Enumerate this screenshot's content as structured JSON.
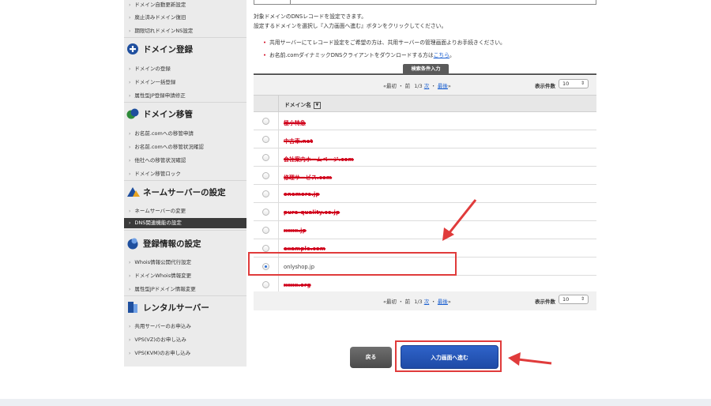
{
  "sidebar": {
    "links_top": [
      "ドメイン自動更新設定",
      "廃止済みドメイン復旧",
      "期限切れドメインNS設定"
    ],
    "sections": [
      {
        "title": "ドメイン登録",
        "icon": "plus-circle-icon",
        "links": [
          "ドメインの登録",
          "ドメイン一括登録",
          "属性型JP登録申請修正"
        ]
      },
      {
        "title": "ドメイン移管",
        "icon": "transfer-icon",
        "links": [
          "お名前.comへの移管申請",
          "お名前.comへの移管状況確認",
          "他社への移管状況確認",
          "ドメイン移管ロック"
        ]
      },
      {
        "title": "ネームサーバーの設定",
        "icon": "nameserver-icon",
        "links": [
          "ネームサーバーの変更",
          "DNS関連機能の設定"
        ]
      },
      {
        "title": "登録情報の設定",
        "icon": "registration-info-icon",
        "links": [
          "Whois情報公開代行設定",
          "ドメインWhois情報変更",
          "属性型JPドメイン情報変更"
        ]
      },
      {
        "title": "レンタルサーバー",
        "icon": "server-icon",
        "links": [
          "共用サーバーのお申込み",
          "VPS(VZ)のお申し込み",
          "VPS(KVM)のお申し込み"
        ]
      }
    ],
    "active_link": "DNS関連機能の設定"
  },
  "main": {
    "intro_line1": "対象ドメインのDNSレコードを設定できます。",
    "intro_line2": "設定するドメインを選択し『入力画面へ進む』ボタンをクリックしてください。",
    "note1": "共用サーバーにてレコード設定をご希望の方は、共用サーバーの管理画面よりお手続きください。",
    "note2_text": "お名前.comダイナミックDNSクライアントをダウンロードする方は",
    "note2_link": "こちら",
    "note2_end": "。",
    "search_tab": "検索条件入力",
    "pager": {
      "first": "«最初",
      "sep": "・",
      "prev": "前",
      "page": "1/3",
      "next": "次",
      "last": "最後",
      "end": "»"
    },
    "per_page_label": "表示件数",
    "per_page_value": "10",
    "column_header": "ドメイン名",
    "sort_icon": "sort-icon",
    "rows": [
      {
        "name": "極小特急",
        "redacted": true
      },
      {
        "name": "中古車.net",
        "redacted": true
      },
      {
        "name": "会社案内ホームページ.com",
        "redacted": true
      },
      {
        "name": "修理サービス.com",
        "redacted": true
      },
      {
        "name": "onemore.jp",
        "redacted": true
      },
      {
        "name": "pure-quality.co.jp",
        "redacted": true
      },
      {
        "name": "xxxx.jp",
        "redacted": true
      },
      {
        "name": "example.com",
        "redacted": true
      },
      {
        "name": "onlyshop.jp",
        "redacted": false,
        "selected": true
      },
      {
        "name": "xxxx.org",
        "redacted": true
      }
    ],
    "back_button": "戻る",
    "next_button": "入力画面へ進む"
  },
  "annotation_color": "#e03b3b"
}
